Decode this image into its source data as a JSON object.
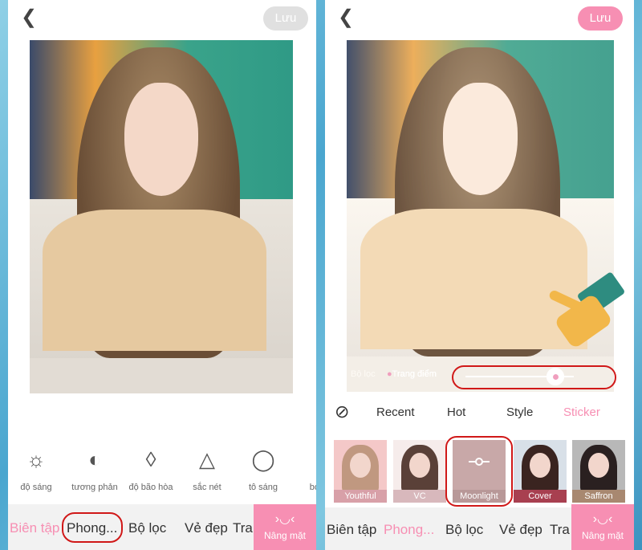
{
  "left": {
    "back_icon": "chevron-left-icon",
    "save_label": "Lưu",
    "save_color": "#e0e0e0",
    "tools": [
      {
        "icon": "sun-icon",
        "glyph": "☼",
        "label": "độ sáng"
      },
      {
        "icon": "contrast-icon",
        "glyph": "◐",
        "label": "tương phản"
      },
      {
        "icon": "droplet-icon",
        "glyph": "◊",
        "label": "độ bão hòa"
      },
      {
        "icon": "triangle-icon",
        "glyph": "△",
        "label": "sắc nét"
      },
      {
        "icon": "highlight-icon",
        "glyph": "◯",
        "label": "tô sáng"
      },
      {
        "icon": "shadow-icon",
        "glyph": "(",
        "label": "bóng"
      }
    ],
    "nav": [
      "Biên tập",
      "Phong...",
      "Bộ lọc",
      "Vẻ đẹp",
      "Tra"
    ],
    "nav_active": 0,
    "face_lift": {
      "icon": "face-lift-icon",
      "glyph": "›◡‹",
      "label": "Nâng mặt"
    }
  },
  "right": {
    "back_icon": "chevron-left-icon",
    "save_label": "Lưu",
    "save_color": "#f78fb3",
    "slider": {
      "left_label": "Bộ lọc",
      "right_label": "Trang điểm",
      "value": 0.83
    },
    "tabs": [
      "Recent",
      "Hot",
      "Style",
      "Sticker"
    ],
    "tab_active": 3,
    "none_icon": "no-style-icon",
    "styles": [
      {
        "label": "Youthful",
        "bg": "#f4c8c8",
        "label_bg": "#d8a0a8"
      },
      {
        "label": "VC",
        "bg": "#f6eceb",
        "label_bg": "#d8b8bc"
      },
      {
        "label": "Moonlight",
        "bg": "#c8a8a8",
        "label_bg": "#b89898"
      },
      {
        "label": "Cover",
        "bg": "#d8e0e8",
        "label_bg": "#a84050"
      },
      {
        "label": "Saffron",
        "bg": "#b8b8b8",
        "label_bg": "#a88870"
      }
    ],
    "nav": [
      "Biên tập",
      "Phong...",
      "Bộ lọc",
      "Vẻ đẹp",
      "Tra"
    ],
    "nav_active": 1,
    "face_lift": {
      "icon": "face-lift-icon",
      "glyph": "›◡‹",
      "label": "Nâng mặt"
    }
  },
  "colors": {
    "accent": "#f78fb3",
    "highlight": "#d01818"
  }
}
